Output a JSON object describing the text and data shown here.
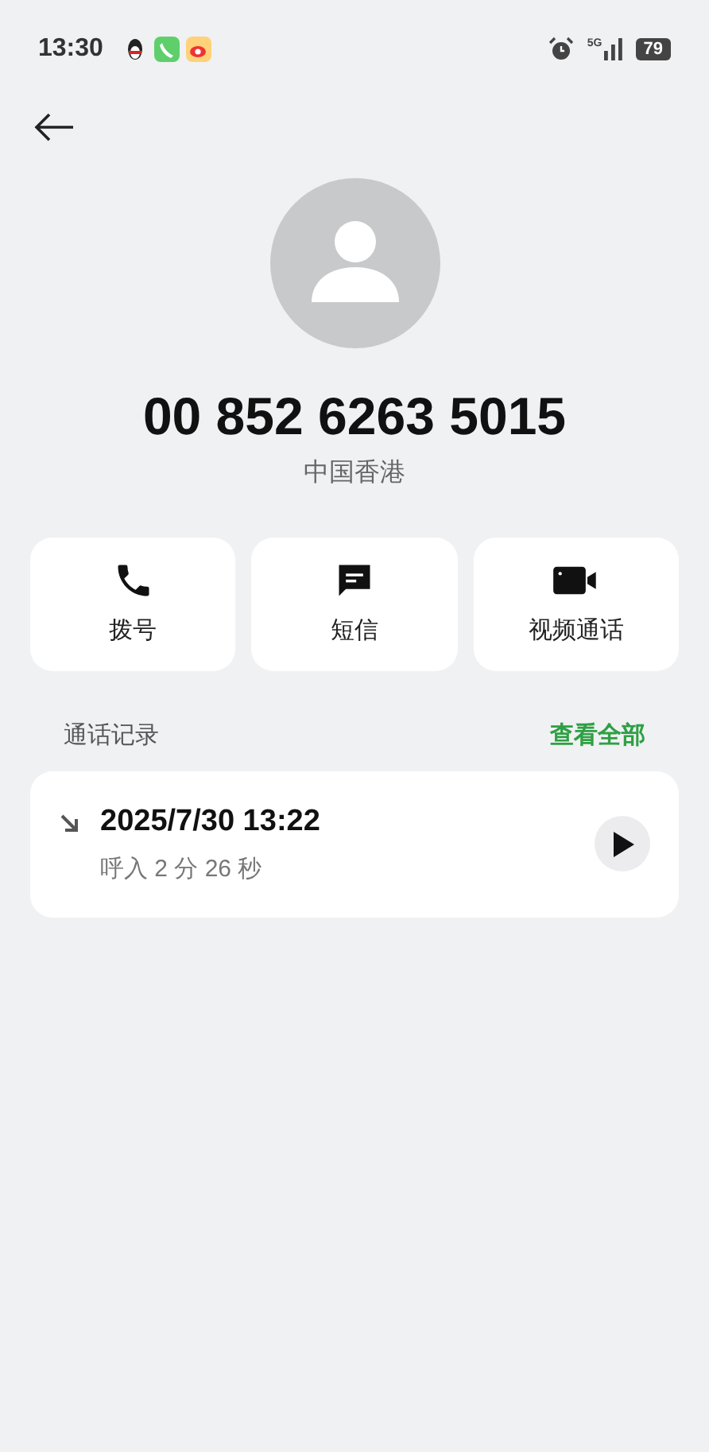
{
  "status_bar": {
    "time": "13:30",
    "network": "5G",
    "battery": "79"
  },
  "contact": {
    "number": "00 852 6263 5015",
    "location": "中国香港"
  },
  "actions": [
    {
      "kind": "call",
      "label": "拨号"
    },
    {
      "kind": "message",
      "label": "短信"
    },
    {
      "kind": "video",
      "label": "视频通话"
    }
  ],
  "call_history": {
    "title": "通话记录",
    "view_all": "查看全部",
    "entries": [
      {
        "kind": "incoming",
        "datetime": "2025/7/30 13:22",
        "detail": "呼入 2 分 26 秒"
      }
    ]
  }
}
